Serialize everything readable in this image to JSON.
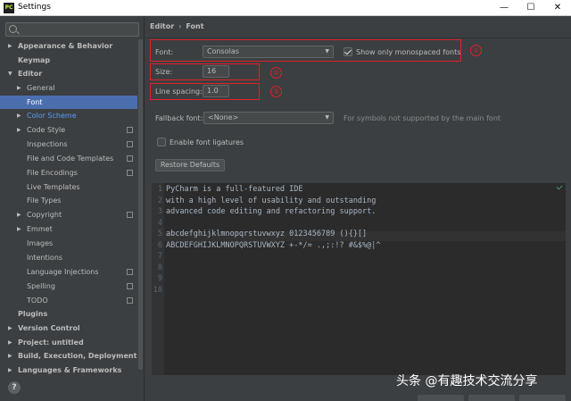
{
  "window": {
    "title": "Settings",
    "app_icon": "PC",
    "controls": {
      "minimize": "—",
      "maximize": "☐",
      "close": "✕"
    }
  },
  "sidebar": {
    "search_placeholder": "",
    "items": [
      {
        "label": "Appearance & Behavior",
        "bold": true,
        "expandable": true,
        "expanded": false
      },
      {
        "label": "Keymap",
        "bold": true
      },
      {
        "label": "Editor",
        "bold": true,
        "expandable": true,
        "expanded": true
      },
      {
        "label": "General",
        "expandable": true
      },
      {
        "label": "Font",
        "selected": true
      },
      {
        "label": "Color Scheme",
        "expandable": true
      },
      {
        "label": "Code Style",
        "expandable": true
      },
      {
        "label": "Inspections"
      },
      {
        "label": "File and Code Templates"
      },
      {
        "label": "File Encodings"
      },
      {
        "label": "Live Templates"
      },
      {
        "label": "File Types"
      },
      {
        "label": "Copyright",
        "expandable": true
      },
      {
        "label": "Emmet",
        "expandable": true
      },
      {
        "label": "Images"
      },
      {
        "label": "Intentions"
      },
      {
        "label": "Language Injections"
      },
      {
        "label": "Spelling"
      },
      {
        "label": "TODO"
      },
      {
        "label": "Plugins",
        "bold": true
      },
      {
        "label": "Version Control",
        "bold": true,
        "expandable": true
      },
      {
        "label": "Project: untitled",
        "bold": true,
        "expandable": true
      },
      {
        "label": "Build, Execution, Deployment",
        "bold": true,
        "expandable": true
      },
      {
        "label": "Languages & Frameworks",
        "bold": true,
        "expandable": true
      }
    ],
    "help_label": "?"
  },
  "breadcrumb": {
    "parent": "Editor",
    "separator": "›",
    "current": "Font"
  },
  "font_settings": {
    "font_label": "Font:",
    "font_value": "Consolas",
    "monospaced_label": "Show only monospaced fonts",
    "monospaced_checked": true,
    "size_label": "Size:",
    "size_value": "16",
    "line_spacing_label": "Line spacing:",
    "line_spacing_value": "1.0",
    "fallback_label": "Fallback font:",
    "fallback_value": "<None>",
    "fallback_hint": "For symbols not supported by the main font",
    "ligatures_label": "Enable font ligatures",
    "ligatures_checked": false,
    "restore_label": "Restore Defaults"
  },
  "annotations": [
    "①",
    "②",
    "③"
  ],
  "preview": {
    "lines": [
      "PyCharm is a full-featured IDE",
      "with a high level of usability and outstanding",
      "advanced code editing and refactoring support.",
      "",
      "abcdefghijklmnopqrstuvwxyz 0123456789 (){}[]",
      "ABCDEFGHIJKLMNOPQRSTUVWXYZ +-*/= .,;:!? #&$%@|^",
      "",
      "",
      "",
      ""
    ],
    "line_numbers": [
      "1",
      "2",
      "3",
      "4",
      "5",
      "6",
      "7",
      "8",
      "9",
      "10"
    ]
  },
  "watermark": "头条 @有趣技术交流分享",
  "colors": {
    "selection": "#4b6eaf",
    "annotation_red": "#e0202a",
    "link_blue": "#589df6"
  }
}
